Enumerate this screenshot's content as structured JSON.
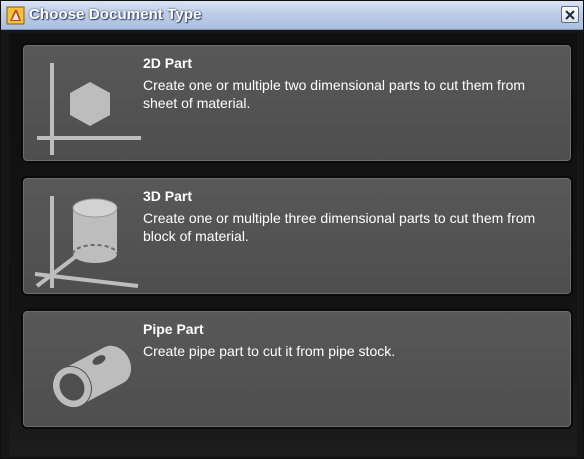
{
  "window": {
    "title": "Choose Document Type",
    "close_label": "close"
  },
  "options": [
    {
      "title": "2D Part",
      "description": "Create one or multiple two dimensional parts to cut them from sheet of material.",
      "icon": "2d-part-icon"
    },
    {
      "title": "3D Part",
      "description": "Create one or multiple three dimensional parts to cut them from block of material.",
      "icon": "3d-part-icon"
    },
    {
      "title": "Pipe Part",
      "description": "Create pipe part to cut it from pipe stock.",
      "icon": "pipe-part-icon"
    }
  ],
  "colors": {
    "card_background": "#555555",
    "card_border": "#0a0a0a",
    "icon_color": "#bdbdbd",
    "titlebar": "#bccce6"
  }
}
